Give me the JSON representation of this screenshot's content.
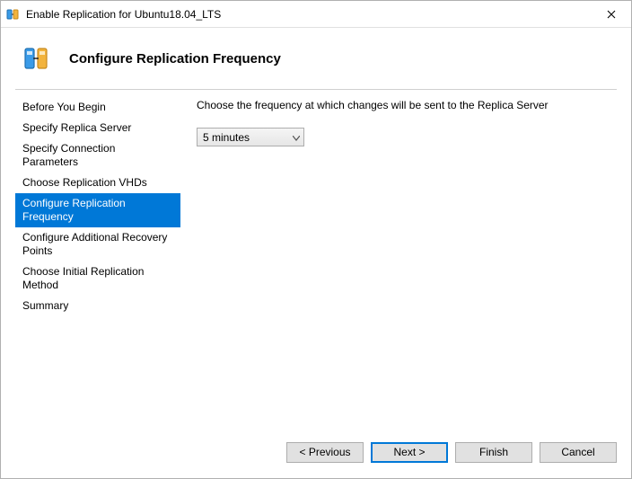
{
  "window": {
    "title": "Enable Replication for Ubuntu18.04_LTS"
  },
  "header": {
    "title": "Configure Replication Frequency"
  },
  "sidebar": {
    "items": [
      {
        "label": "Before You Begin"
      },
      {
        "label": "Specify Replica Server"
      },
      {
        "label": "Specify Connection Parameters"
      },
      {
        "label": "Choose Replication VHDs"
      },
      {
        "label": "Configure Replication Frequency"
      },
      {
        "label": "Configure Additional Recovery Points"
      },
      {
        "label": "Choose Initial Replication Method"
      },
      {
        "label": "Summary"
      }
    ],
    "selected_index": 4
  },
  "content": {
    "instruction": "Choose the frequency at which changes will be sent to the Replica Server",
    "frequency_value": "5 minutes"
  },
  "footer": {
    "previous": "< Previous",
    "next": "Next >",
    "finish": "Finish",
    "cancel": "Cancel"
  },
  "colors": {
    "selection": "#0078d7"
  }
}
